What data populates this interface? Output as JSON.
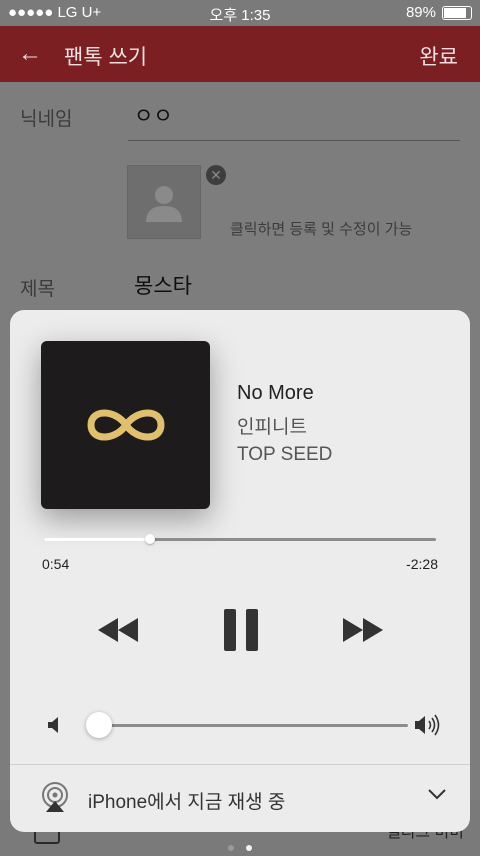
{
  "status": {
    "carrier": "●●●●● LG U+",
    "time": "오후 1:35",
    "battery": "89%"
  },
  "header": {
    "title": "팬톡 쓰기",
    "done": "완료"
  },
  "form": {
    "nickname_label": "닉네임",
    "nickname_value": "ㅇㅇ",
    "image_hint": "클릭하면 등록 및 수정이 가능",
    "title_label": "제목",
    "title_value": "몽스타",
    "bottom_text": "앨리크 미미"
  },
  "player": {
    "song": "No More",
    "artist": "인피니트",
    "album": "TOP SEED",
    "elapsed": "0:54",
    "remaining": "-2:28",
    "progress": 0.27,
    "volume": 0.04,
    "device": "iPhone에서 지금 재생 중",
    "art_color": "#1d1b1c",
    "logo_color": "#e0c06a"
  },
  "page_dots": {
    "count": 2,
    "active": 2
  }
}
